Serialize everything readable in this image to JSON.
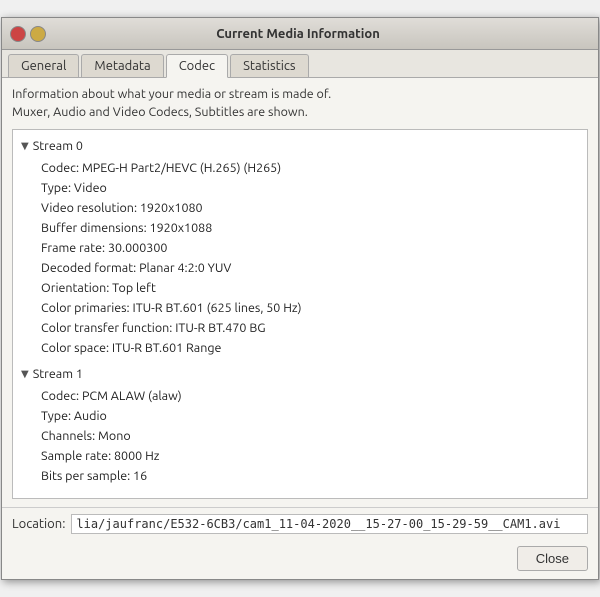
{
  "window": {
    "title": "Current Media Information"
  },
  "tabs": [
    {
      "label": "General",
      "active": false
    },
    {
      "label": "Metadata",
      "active": false
    },
    {
      "label": "Codec",
      "active": true
    },
    {
      "label": "Statistics",
      "active": false
    }
  ],
  "info_line1": "Information about what your media or stream is made of.",
  "info_line2": "Muxer, Audio and Video Codecs, Subtitles are shown.",
  "streams": [
    {
      "header": "Stream 0",
      "items": [
        "Codec: MPEG-H Part2/HEVC (H.265) (H265)",
        "Type: Video",
        "Video resolution: 1920x1080",
        "Buffer dimensions: 1920x1088",
        "Frame rate: 30.000300",
        "Decoded format: Planar 4:2:0 YUV",
        "Orientation: Top left",
        "Color primaries: ITU-R BT.601 (625 lines, 50 Hz)",
        "Color transfer function: ITU-R BT.470 BG",
        "Color space: ITU-R BT.601 Range"
      ]
    },
    {
      "header": "Stream 1",
      "items": [
        "Codec: PCM ALAW (alaw)",
        "Type: Audio",
        "Channels: Mono",
        "Sample rate: 8000 Hz",
        "Bits per sample: 16"
      ]
    }
  ],
  "location": {
    "label": "Location:",
    "value": "lia/jaufranc/E532-6CB3/cam1_11-04-2020__15-27-00_15-29-59__CAM1.avi"
  },
  "buttons": {
    "close": "Close"
  }
}
